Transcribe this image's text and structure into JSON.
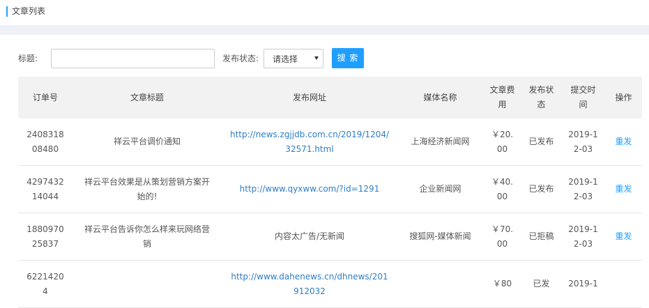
{
  "header": {
    "title": "文章列表"
  },
  "filter": {
    "title_label": "标题:",
    "title_value": "",
    "status_label": "发布状态:",
    "status_value": "请选择",
    "search_button": "搜 索"
  },
  "table": {
    "headers": {
      "order_no": "订单号",
      "article_title": "文章标题",
      "publish_url": "发布网址",
      "media_name": "媒体名称",
      "fee": "文章费用",
      "status": "发布状态",
      "submit_time": "提交时间",
      "action": "操作"
    },
    "rows": [
      {
        "order_no": "240831808480",
        "title": "祥云平台调价通知",
        "url": "http://news.zgjjdb.com.cn/2019/1204/32571.html",
        "media": "上海经济新闻网",
        "fee": "￥20.00",
        "status": "已发布",
        "time": "2019-12-03",
        "action": "重发"
      },
      {
        "order_no": "429743214044",
        "title": "祥云平台效果是从策划营销方案开始的!",
        "url": "http://www.qyxww.com/?id=1291",
        "media": "企业新闻网",
        "fee": "￥40.00",
        "status": "已发布",
        "time": "2019-12-03",
        "action": "重发"
      },
      {
        "order_no": "188097025837",
        "title": "祥云平台告诉你怎么样来玩网络营销",
        "url": "内容太广告/无新闻",
        "media": "搜狐网-媒体新闻",
        "fee": "￥70.00",
        "status": "已拒稿",
        "time": "2019-12-03",
        "action": "重发"
      },
      {
        "order_no": "62214204",
        "title": "",
        "url": "http://www.dahenews.cn/dhnews/201912032",
        "media": "",
        "fee": "￥80",
        "status": "已发",
        "time": "2019-1",
        "action": ""
      }
    ]
  }
}
